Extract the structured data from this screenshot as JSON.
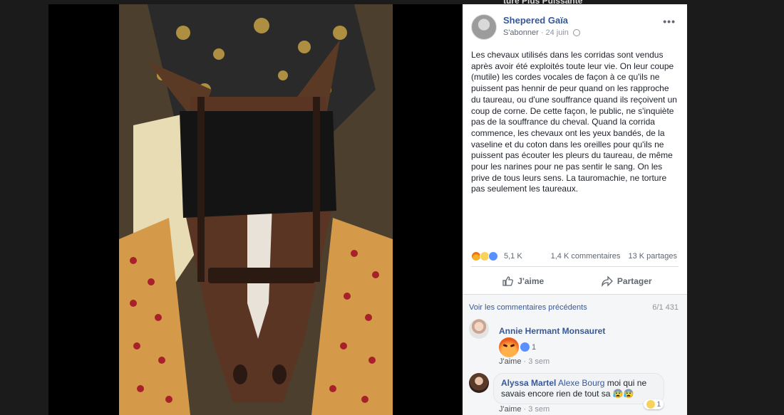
{
  "background_ghost_text": "ture Plus Puissante",
  "post": {
    "author": "Shepered Gaïa",
    "follow_label": "S'abonner",
    "date": "24 juin",
    "text": "Les chevaux utilisés dans les corridas sont vendus après avoir été exploités toute leur vie. On leur coupe (mutile) les cordes vocales de façon à ce qu'ils ne puissent pas hennir de peur quand on les rapproche du taureau, ou d'une souffrance quand ils reçoivent un coup de corne. De cette façon, le public, ne s'inquiète pas de la souffrance du cheval. Quand la corrida commence, les chevaux ont les yeux bandés, de la vaseline et du coton dans les oreilles pour qu'ils ne puissent pas écouter les pleurs du taureau, de même pour les narines pour ne pas sentir le sang. On les prive de tous leurs sens. La tauromachie, ne torture pas seulement les taureaux.",
    "reactions_count": "5,1 K",
    "comments_count": "1,4 K commentaires",
    "shares_count": "13 K partages",
    "like_label": "J'aime",
    "share_label": "Partager",
    "reaction_icons": [
      "angry-icon",
      "sad-icon",
      "like-icon"
    ]
  },
  "comments_section": {
    "previous_label": "Voir les commentaires précédents",
    "pagination": "6/1 431",
    "comments": [
      {
        "author": "Annie Hermant Monsauret",
        "sticker": "angry-emoji",
        "reaction_count": "1",
        "like_label": "J'aime",
        "time": "3 sem"
      },
      {
        "author": "Alyssa Martel",
        "mention": "Alexe Bourg",
        "text": "moi qui ne savais encore rien de tout sa 😰😰",
        "reaction_count": "1",
        "like_label": "J'aime",
        "time": "3 sem"
      }
    ]
  },
  "colors": {
    "link_blue": "#365899",
    "muted_text": "#90949c",
    "page_bg": "#1b1b1b"
  }
}
